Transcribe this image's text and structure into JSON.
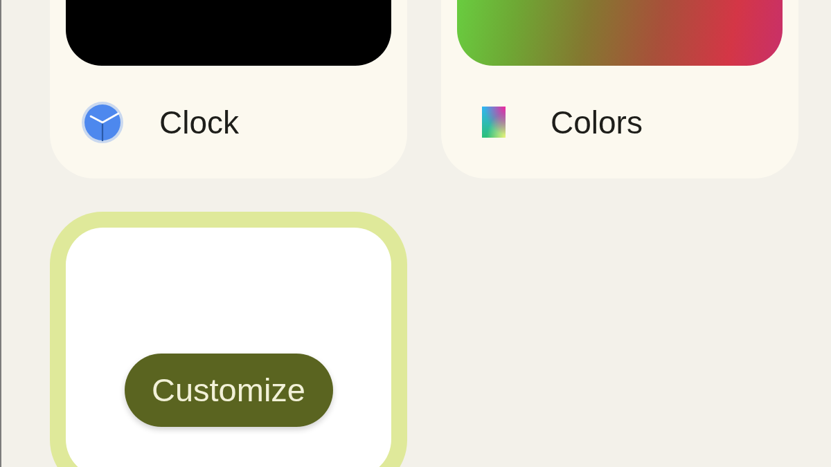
{
  "options": [
    {
      "kind": "clock",
      "label": "Clock",
      "selected": false
    },
    {
      "kind": "colors",
      "label": "Colors",
      "selected": false
    },
    {
      "kind": "custom",
      "button": "Customize",
      "selected": true
    }
  ]
}
